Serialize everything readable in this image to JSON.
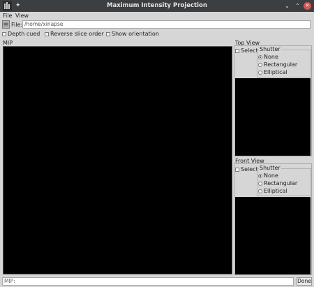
{
  "window": {
    "title": "Maximum Intensity Projection",
    "controls": {
      "minimize": "⌄",
      "maximize": "⌃",
      "close": "✕"
    }
  },
  "menubar": {
    "items": [
      "File",
      "View"
    ]
  },
  "file": {
    "label": "File:",
    "path": "/home/xinapse"
  },
  "options": {
    "depth_cued": "Depth cued",
    "reverse_slice_order": "Reverse slice order",
    "show_orientation": "Show orientation"
  },
  "mip": {
    "label": "MIP"
  },
  "top_view": {
    "label": "Top View",
    "select": "Select",
    "shutter": {
      "title": "Shutter",
      "options": [
        "None",
        "Rectangular",
        "Elliptical"
      ],
      "selected": "None"
    }
  },
  "front_view": {
    "label": "Front View",
    "select": "Select",
    "shutter": {
      "title": "Shutter",
      "options": [
        "None",
        "Rectangular",
        "Elliptical"
      ],
      "selected": "None"
    }
  },
  "status": {
    "text": "MIP:",
    "done": "Done"
  },
  "icons": [
    "app-icon",
    "pin-icon",
    "folder-icon",
    "minimize-icon",
    "maximize-icon",
    "close-icon"
  ],
  "colors": {
    "titlebar": "#3c3f41",
    "close": "#d9534f",
    "canvas": "#000000"
  }
}
